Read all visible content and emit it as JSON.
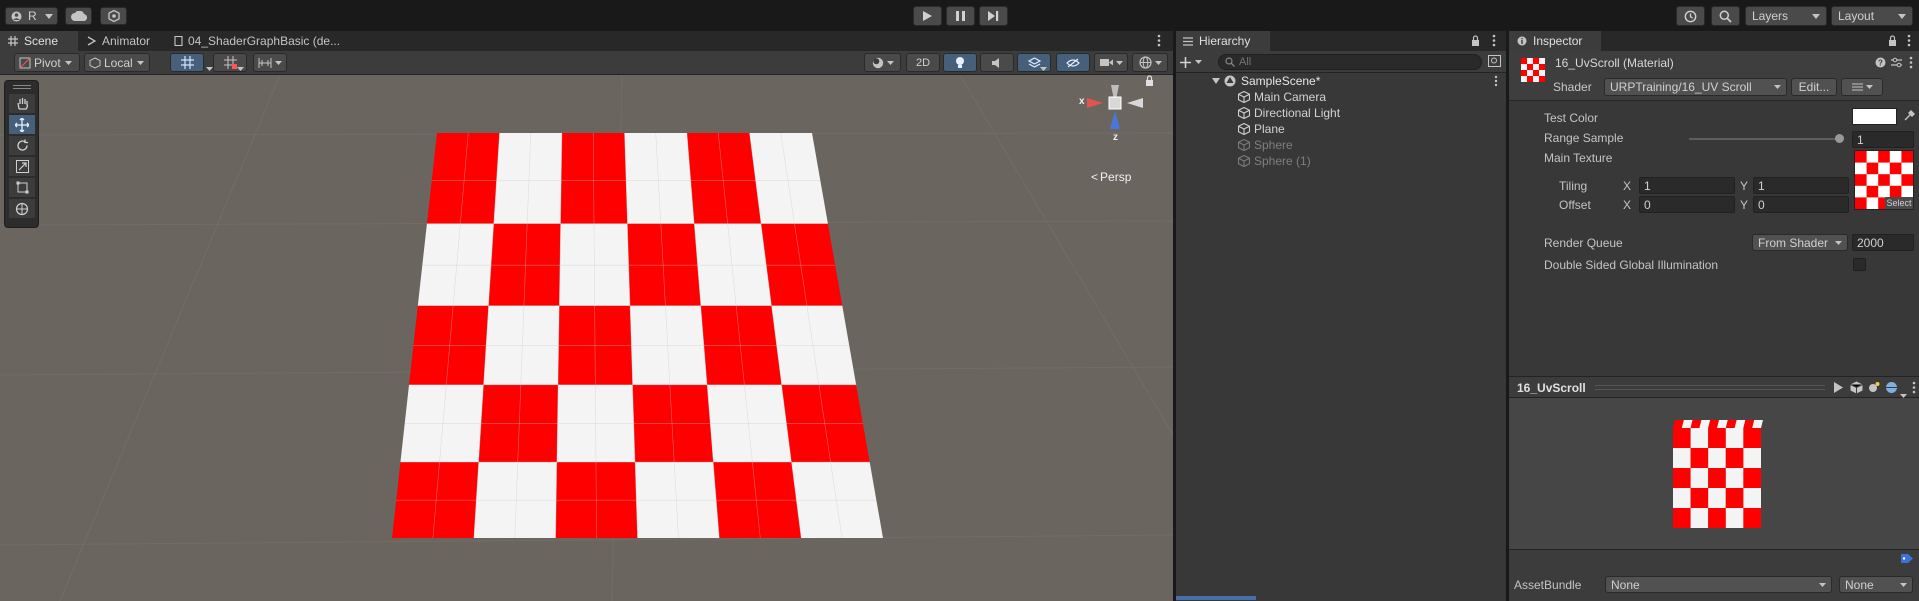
{
  "toolbar": {
    "account_initial": "R",
    "layers_label": "Layers",
    "layout_label": "Layout"
  },
  "scene_panel": {
    "tabs": [
      {
        "label": "Scene"
      },
      {
        "label": "Animator"
      },
      {
        "label": "04_ShaderGraphBasic (de..."
      }
    ],
    "pivot_label": "Pivot",
    "local_label": "Local",
    "mode_2d_label": "2D",
    "view_label": "Persp",
    "gizmo_axes": {
      "x": "x",
      "z": "z"
    },
    "checker_colors": {
      "red": "#ff0000",
      "white": "#f4f4f4"
    }
  },
  "hierarchy": {
    "tab_label": "Hierarchy",
    "search_placeholder": "All",
    "scene_name": "SampleScene*",
    "items": [
      {
        "label": "Main Camera",
        "active": true
      },
      {
        "label": "Directional Light",
        "active": true
      },
      {
        "label": "Plane",
        "active": true
      },
      {
        "label": "Sphere",
        "active": false
      },
      {
        "label": "Sphere (1)",
        "active": false
      }
    ]
  },
  "inspector": {
    "tab_label": "Inspector",
    "material_name": "16_UvScroll (Material)",
    "shader_label": "Shader",
    "shader_value": "URPTraining/16_UV Scroll",
    "edit_label": "Edit...",
    "props": {
      "test_color_label": "Test Color",
      "test_color_value": "#ffffff",
      "range_sample_label": "Range Sample",
      "range_sample_value": "1",
      "range_sample_fraction": 1.0,
      "main_texture_label": "Main Texture",
      "tiling_label": "Tiling",
      "offset_label": "Offset",
      "x_label": "X",
      "y_label": "Y",
      "tiling_x": "1",
      "tiling_y": "1",
      "offset_x": "0",
      "offset_y": "0",
      "select_label": "Select",
      "render_queue_label": "Render Queue",
      "render_queue_mode": "From Shader",
      "render_queue_value": "2000",
      "double_sided_label": "Double Sided Global Illumination",
      "double_sided_checked": false
    },
    "preview_title": "16_UvScroll",
    "assetbundle_label": "AssetBundle",
    "assetbundle_name": "None",
    "assetbundle_variant": "None"
  }
}
